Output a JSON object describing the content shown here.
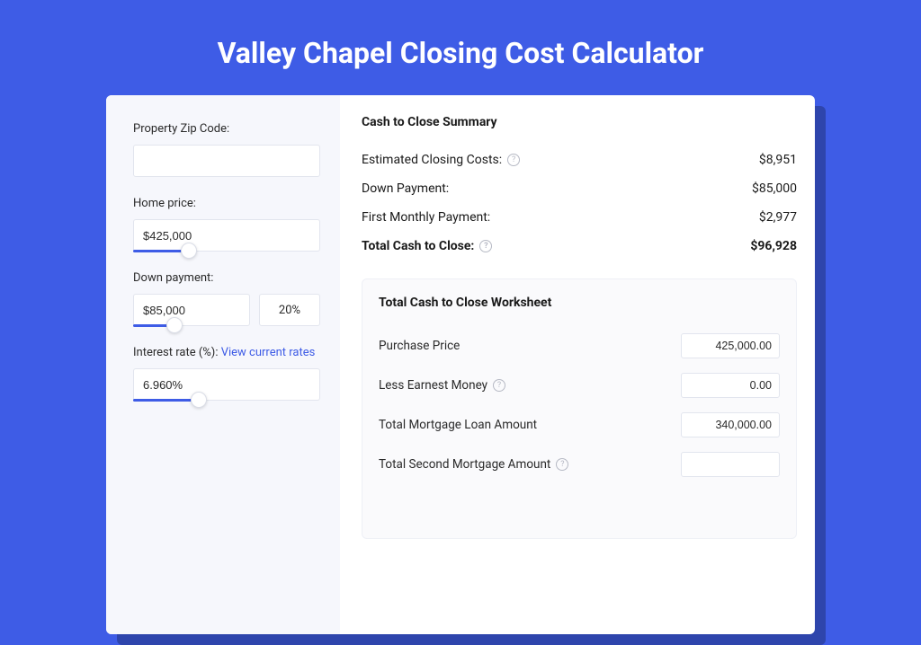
{
  "title": "Valley Chapel Closing Cost Calculator",
  "left": {
    "zip": {
      "label": "Property Zip Code:",
      "value": ""
    },
    "home_price": {
      "label": "Home price:",
      "value": "$425,000",
      "slider_pct": 30
    },
    "down_payment": {
      "label": "Down payment:",
      "value": "$85,000",
      "pct": "20%",
      "slider_pct": 35
    },
    "interest": {
      "label": "Interest rate (%):",
      "link_text": "View current rates",
      "value": "6.960%",
      "slider_pct": 35
    }
  },
  "summary": {
    "title": "Cash to Close Summary",
    "rows": [
      {
        "label": "Estimated Closing Costs:",
        "info": true,
        "value": "$8,951",
        "bold": false
      },
      {
        "label": "Down Payment:",
        "info": false,
        "value": "$85,000",
        "bold": false
      },
      {
        "label": "First Monthly Payment:",
        "info": false,
        "value": "$2,977",
        "bold": false
      },
      {
        "label": "Total Cash to Close:",
        "info": true,
        "value": "$96,928",
        "bold": true
      }
    ]
  },
  "worksheet": {
    "title": "Total Cash to Close Worksheet",
    "rows": [
      {
        "label": "Purchase Price",
        "info": false,
        "value": "425,000.00"
      },
      {
        "label": "Less Earnest Money",
        "info": true,
        "value": "0.00"
      },
      {
        "label": "Total Mortgage Loan Amount",
        "info": false,
        "value": "340,000.00"
      },
      {
        "label": "Total Second Mortgage Amount",
        "info": true,
        "value": ""
      }
    ]
  }
}
